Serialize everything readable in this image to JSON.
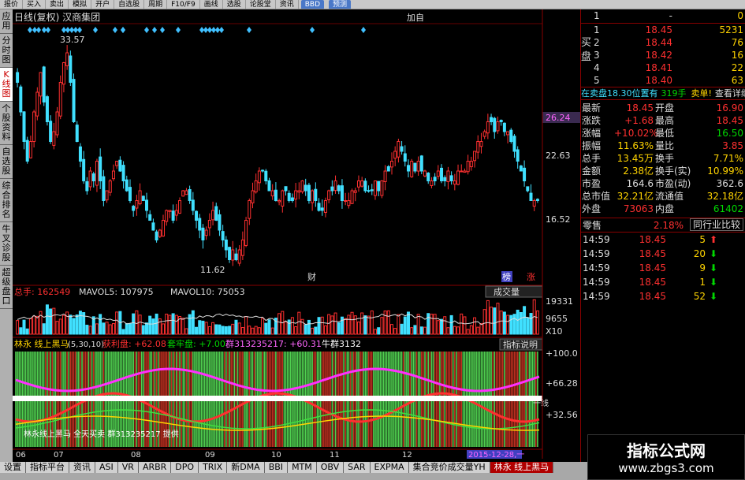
{
  "topbar": [
    "报价",
    "买入",
    "卖出",
    "模拟",
    "开户",
    "自选股",
    "周期",
    "F10/F9",
    "画线",
    "选股",
    "论股堂",
    "资讯"
  ],
  "topbar_badges": [
    "BBD",
    "预测"
  ],
  "leftbar": [
    "应用",
    "分时图",
    "K线图",
    "个股资料",
    "自选股",
    "综合排名",
    "牛叉诊股",
    "超级盘口"
  ],
  "leftbar_active": 2,
  "main": {
    "title": "日线(复权)  汉商集团",
    "add_label": "加自",
    "high_label": "33.57",
    "low_label": "11.62",
    "price_ticks": [
      "26.24",
      "22.63",
      "16.52"
    ],
    "tag_cai": "财",
    "tag_bang": "榜",
    "tag_zhang": "涨"
  },
  "volume": {
    "zongshou_label": "总手: 162549",
    "mavol5_label": "MAVOL5: 107975",
    "mavol10_label": "MAVOL10: 75053",
    "dropdown": "成交量",
    "ticks": [
      "19331",
      "9655",
      "X10"
    ]
  },
  "indicator": {
    "name": "林永 线上黑马",
    "params": "(5,30,10)",
    "huoli": "获利盘: +62.08",
    "taolao": "套牢盘: +7.00",
    "qun": "群313235217: +60.31",
    "niuqun": "牛群3132",
    "help": "指标说明",
    "ticks": [
      "+100.0",
      "+66.28",
      "+32.56"
    ],
    "bottom_text": "林永线上黑马  全天买卖   群313235217  提供",
    "right_tag": "一线"
  },
  "xaxis": [
    "06",
    "07",
    "08",
    "09",
    "10",
    "11",
    "12"
  ],
  "xaxis_date": "2015-12-28,一",
  "orderbook": {
    "sell": [
      {
        "lvl": "1",
        "price": "-",
        "vol": "0"
      }
    ],
    "buy_label": "买盘",
    "buy": [
      {
        "lvl": "1",
        "price": "18.45",
        "vol": "5231"
      },
      {
        "lvl": "2",
        "price": "18.44",
        "vol": "76"
      },
      {
        "lvl": "3",
        "price": "18.42",
        "vol": "16"
      },
      {
        "lvl": "4",
        "price": "18.41",
        "vol": "22"
      },
      {
        "lvl": "5",
        "price": "18.40",
        "vol": "63"
      }
    ],
    "notice": "在卖盘18.30位置有",
    "notice_vol": "319手",
    "notice_action": "卖单!",
    "notice_link": "查看详细"
  },
  "quote": [
    {
      "k1": "最新",
      "v1": "18.45",
      "c1": "red",
      "k2": "开盘",
      "v2": "16.90",
      "c2": "red"
    },
    {
      "k1": "涨跌",
      "v1": "+1.68",
      "c1": "red",
      "k2": "最高",
      "v2": "18.45",
      "c2": "red"
    },
    {
      "k1": "涨幅",
      "v1": "+10.02%",
      "c1": "red",
      "k2": "最低",
      "v2": "16.50",
      "c2": "green"
    },
    {
      "k1": "振幅",
      "v1": "11.63%",
      "c1": "yellow",
      "k2": "量比",
      "v2": "3.85",
      "c2": "red"
    },
    {
      "k1": "总手",
      "v1": "13.45万",
      "c1": "yellow",
      "k2": "换手",
      "v2": "7.71%",
      "c2": "yellow"
    },
    {
      "k1": "金额",
      "v1": "2.38亿",
      "c1": "yellow",
      "k2": "换手(实)",
      "v2": "10.99%",
      "c2": "yellow"
    },
    {
      "k1": "市盈",
      "v1": "164.6",
      "c1": "white",
      "k2": "市盈(动)",
      "v2": "362.6",
      "c2": "white"
    },
    {
      "k1": "总市值",
      "v1": "32.21亿",
      "c1": "yellow",
      "k2": "流通值",
      "v2": "32.18亿",
      "c2": "yellow"
    },
    {
      "k1": "外盘",
      "v1": "73063",
      "c1": "red",
      "k2": "内盘",
      "v2": "61402",
      "c2": "green"
    }
  ],
  "industry": {
    "label": "零售",
    "pct": "2.18%",
    "compare": "同行业比较"
  },
  "ticks": [
    {
      "t": "14:59",
      "p": "18.45",
      "v": "5",
      "d": "up"
    },
    {
      "t": "14:59",
      "p": "18.45",
      "v": "20",
      "d": "down"
    },
    {
      "t": "14:59",
      "p": "18.45",
      "v": "9",
      "d": "down"
    },
    {
      "t": "14:59",
      "p": "18.45",
      "v": "1",
      "d": "down"
    },
    {
      "t": "14:59",
      "p": "18.45",
      "v": "52",
      "d": "down"
    }
  ],
  "bottombar": [
    "设置",
    "指标平台",
    "资讯",
    "ASI",
    "VR",
    "ARBR",
    "DPO",
    "TRIX",
    "新DMA",
    "BBI",
    "MTM",
    "OBV",
    "SAR",
    "EXPMA",
    "集合竞价成交量YH",
    "林永 线上黑马"
  ],
  "bottombar_active": 15,
  "watermark": {
    "line1": "指标公式网",
    "line2": "www.zbgs3.com"
  },
  "colors": {
    "up": "#ff3030",
    "down": "#40e0ff",
    "bg": "#000000",
    "ma": "#ffffff"
  },
  "chart_data": {
    "type": "candlestick",
    "ylim": [
      11,
      35
    ],
    "closes": [
      30,
      27,
      24,
      22,
      24,
      27,
      29,
      31,
      28,
      26,
      24,
      25,
      27,
      30,
      32,
      33,
      30,
      26,
      24,
      22,
      20,
      19,
      21,
      20,
      22,
      20,
      18,
      19,
      20,
      21,
      22,
      21,
      20,
      19,
      18,
      17,
      18,
      19,
      18,
      17,
      16,
      15,
      14,
      15,
      16,
      17,
      17,
      16,
      17,
      18,
      19,
      19,
      18,
      17,
      16,
      15,
      14,
      15,
      16,
      17,
      16,
      15,
      14,
      13,
      12,
      13,
      12,
      13,
      14,
      16,
      18,
      19,
      20,
      21,
      21,
      20,
      19,
      19,
      18,
      18,
      19,
      19,
      18,
      18,
      19,
      19,
      20,
      19,
      18,
      19,
      18,
      17,
      17,
      18,
      19,
      19,
      20,
      19,
      18,
      18,
      18,
      19,
      19,
      20,
      20,
      19,
      19,
      19,
      20,
      19,
      20,
      21,
      21,
      22,
      23,
      24,
      23,
      22,
      21,
      22,
      21,
      22,
      21,
      21,
      20,
      20,
      20,
      21,
      20,
      20,
      21,
      20,
      20,
      21,
      21,
      21,
      22,
      22,
      23,
      24,
      24,
      25,
      26,
      26,
      25,
      26,
      26,
      25,
      25,
      24,
      23,
      22,
      21,
      20,
      19,
      18,
      18,
      18
    ]
  }
}
